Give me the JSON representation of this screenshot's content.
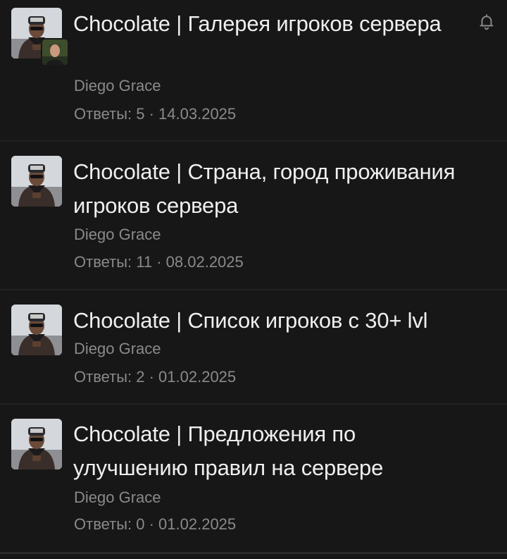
{
  "threads": [
    {
      "title": "Chocolate | Галерея игроков сервера",
      "author": "Diego Grace",
      "replies_label": "Ответы: 5",
      "separator": " · ",
      "date": "14.03.2025",
      "has_bell": true,
      "has_second_avatar": true
    },
    {
      "title": "Chocolate | Страна, город проживания игроков сервера",
      "author": "Diego Grace",
      "replies_label": "Ответы: 11",
      "separator": " · ",
      "date": "08.02.2025",
      "has_bell": false,
      "has_second_avatar": false
    },
    {
      "title": "Chocolate | Список игроков с 30+ lvl",
      "author": "Diego Grace",
      "replies_label": "Ответы: 2",
      "separator": " · ",
      "date": "01.02.2025",
      "has_bell": false,
      "has_second_avatar": false
    },
    {
      "title": "Chocolate | Предложения по улучшению правил на сервере",
      "author": "Diego Grace",
      "replies_label": "Ответы: 0",
      "separator": " · ",
      "date": "01.02.2025",
      "has_bell": false,
      "has_second_avatar": false
    }
  ],
  "icons": {
    "bell": "bell-icon",
    "avatar": "user-avatar"
  },
  "colors": {
    "background": "#171717",
    "title": "#efefef",
    "muted": "#8a8a8a",
    "divider": "#222222"
  }
}
